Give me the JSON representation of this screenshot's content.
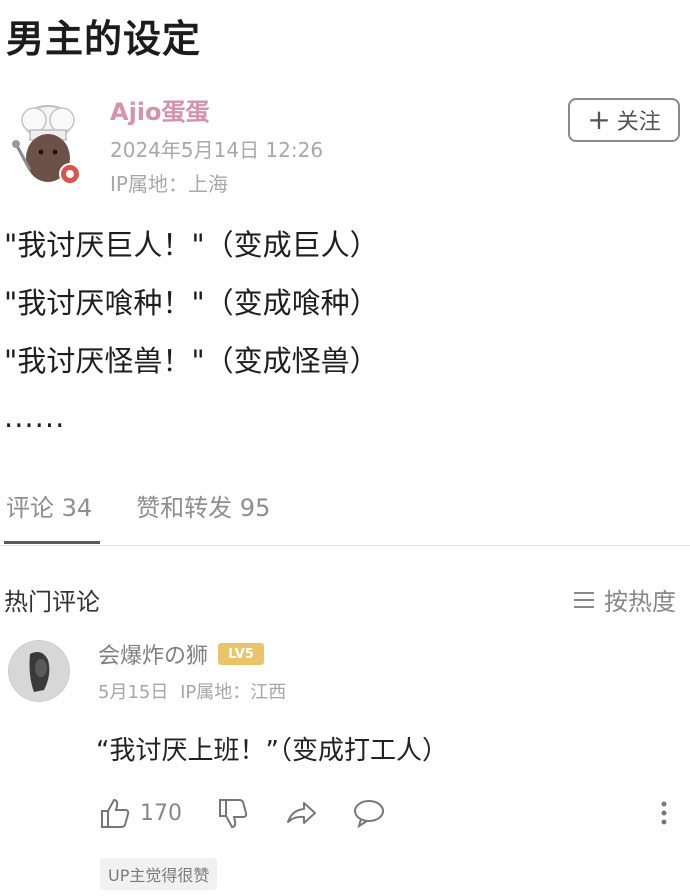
{
  "page": {
    "title": "男主的设定"
  },
  "post": {
    "author": "Ajio蛋蛋",
    "time": "2024年5月14日 12:26",
    "ip": "IP属地：上海",
    "follow_label": "关注",
    "lines": [
      "\"我讨厌巨人！\"（变成巨人）",
      "\"我讨厌喰种！\"（变成喰种）",
      "\"我讨厌怪兽！\"（变成怪兽）"
    ],
    "ellipsis": "......"
  },
  "tabs": {
    "comments": "评论 34",
    "likes_reposts": "赞和转发 95"
  },
  "hot_comments": {
    "title": "热门评论",
    "sort_label": "按热度"
  },
  "comment": {
    "user": "会爆炸の狮",
    "level": "LV5",
    "date": "5月15日",
    "ip": "IP属地：江西",
    "text": "“我讨厌上班！”（变成打工人）",
    "like_count": "170",
    "badge": "UP主觉得很赞"
  },
  "colors": {
    "author": "#d692a8",
    "meta": "#a8a8a8",
    "level_badge": "#e9c46a"
  }
}
